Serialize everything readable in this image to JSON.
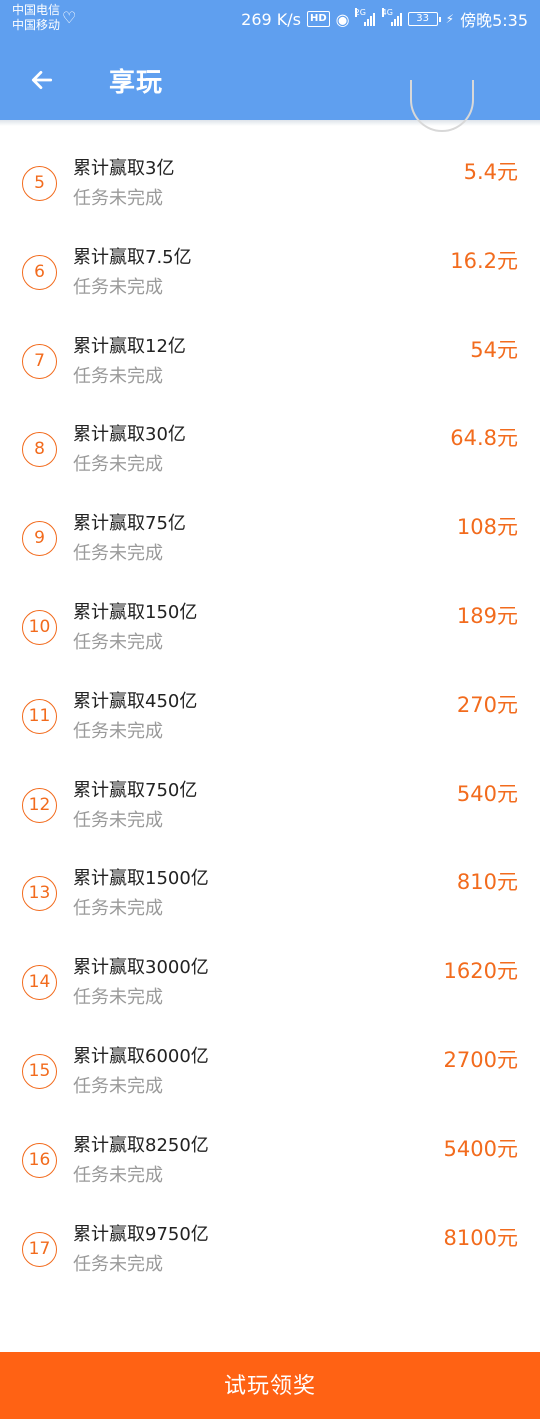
{
  "status_bar": {
    "carrier_1": "中国电信",
    "carrier_2": "中国移动",
    "net_speed": "269 K/s",
    "hd_badge": "HD",
    "signal_1_tag": "2G",
    "signal_2_tag": "4G",
    "battery": "33",
    "time": "傍晚5:35"
  },
  "header": {
    "title": "享玩",
    "back_icon": "back-arrow-icon"
  },
  "tasks": [
    {
      "num": "5",
      "title": "累计赢取3亿",
      "status": "任务未完成",
      "reward": "5.4元"
    },
    {
      "num": "6",
      "title": "累计赢取7.5亿",
      "status": "任务未完成",
      "reward": "16.2元"
    },
    {
      "num": "7",
      "title": "累计赢取12亿",
      "status": "任务未完成",
      "reward": "54元"
    },
    {
      "num": "8",
      "title": "累计赢取30亿",
      "status": "任务未完成",
      "reward": "64.8元"
    },
    {
      "num": "9",
      "title": "累计赢取75亿",
      "status": "任务未完成",
      "reward": "108元"
    },
    {
      "num": "10",
      "title": "累计赢取150亿",
      "status": "任务未完成",
      "reward": "189元"
    },
    {
      "num": "11",
      "title": "累计赢取450亿",
      "status": "任务未完成",
      "reward": "270元"
    },
    {
      "num": "12",
      "title": "累计赢取750亿",
      "status": "任务未完成",
      "reward": "540元"
    },
    {
      "num": "13",
      "title": "累计赢取1500亿",
      "status": "任务未完成",
      "reward": "810元"
    },
    {
      "num": "14",
      "title": "累计赢取3000亿",
      "status": "任务未完成",
      "reward": "1620元"
    },
    {
      "num": "15",
      "title": "累计赢取6000亿",
      "status": "任务未完成",
      "reward": "2700元"
    },
    {
      "num": "16",
      "title": "累计赢取8250亿",
      "status": "任务未完成",
      "reward": "5400元"
    },
    {
      "num": "17",
      "title": "累计赢取9750亿",
      "status": "任务未完成",
      "reward": "8100元"
    }
  ],
  "bottom_button": {
    "label": "试玩领奖"
  },
  "colors": {
    "header_blue": "#5f9fef",
    "accent_orange": "#f26b1d",
    "button_orange": "#ff6214"
  }
}
